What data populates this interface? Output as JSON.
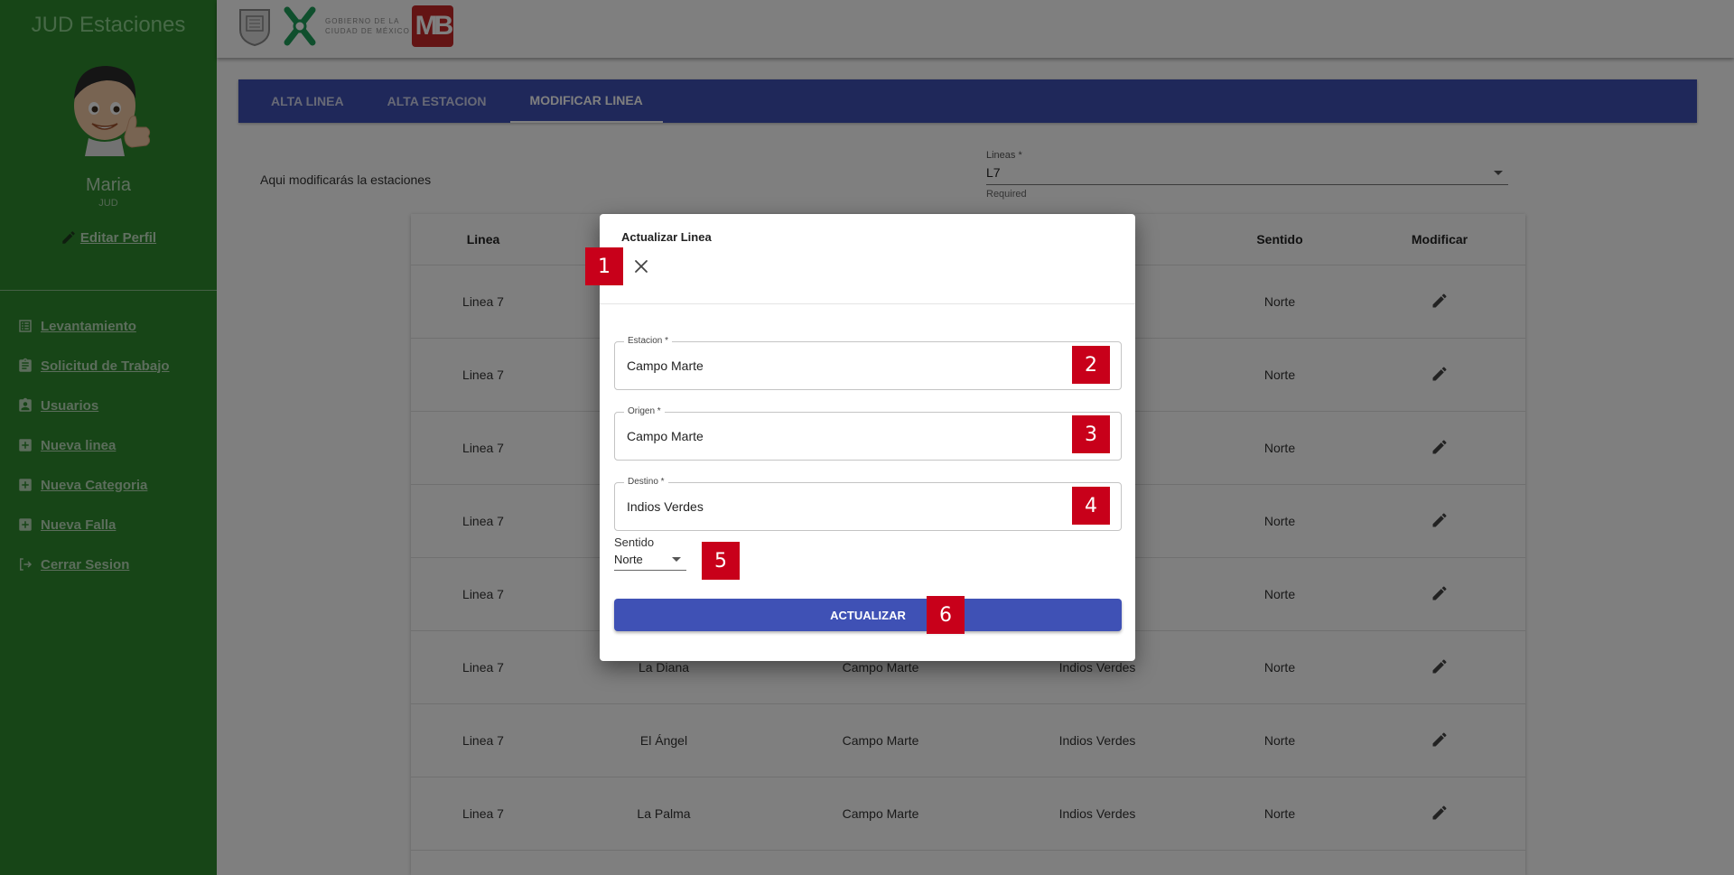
{
  "sidebar": {
    "brand": "JUD Estaciones",
    "user_name": "Maria",
    "user_role": "JUD",
    "edit_profile": "Editar Perfil",
    "items": [
      {
        "label": "Levantamiento",
        "icon": "list-icon"
      },
      {
        "label": "Solicitud de Trabajo",
        "icon": "clipboard-icon"
      },
      {
        "label": "Usuarios",
        "icon": "user-badge-icon"
      },
      {
        "label": "Nueva linea",
        "icon": "add-box-icon"
      },
      {
        "label": "Nueva Categoria",
        "icon": "add-box-icon"
      },
      {
        "label": "Nueva Falla",
        "icon": "add-box-icon"
      },
      {
        "label": "Cerrar Sesion",
        "icon": "logout-icon"
      }
    ]
  },
  "header": {
    "logo_text_line1": "GOBIERNO DE LA",
    "logo_text_line2": "CIUDAD DE MÉXICO"
  },
  "tabs": [
    {
      "label": "ALTA LINEA",
      "active": false
    },
    {
      "label": "ALTA ESTACION",
      "active": false
    },
    {
      "label": "MODIFICAR LINEA",
      "active": true
    }
  ],
  "main": {
    "description": "Aqui modificarás la estaciones",
    "lines_select": {
      "label": "Lineas *",
      "value": "L7",
      "helper": "Required"
    }
  },
  "table": {
    "headers": [
      "Linea",
      "",
      "",
      "",
      "Sentido",
      "Modificar"
    ],
    "rows": [
      [
        "Linea 7",
        "",
        "",
        "",
        "Norte"
      ],
      [
        "Linea 7",
        "",
        "",
        "",
        "Norte"
      ],
      [
        "Linea 7",
        "",
        "",
        "",
        "Norte"
      ],
      [
        "Linea 7",
        "",
        "",
        "",
        "Norte"
      ],
      [
        "Linea 7",
        "",
        "",
        "",
        "Norte"
      ],
      [
        "Linea 7",
        "La Diana",
        "Campo Marte",
        "Indios Verdes",
        "Norte"
      ],
      [
        "Linea 7",
        "El Ángel",
        "Campo Marte",
        "Indios Verdes",
        "Norte"
      ],
      [
        "Linea 7",
        "La Palma",
        "Campo Marte",
        "Indios Verdes",
        "Norte"
      ]
    ]
  },
  "modal": {
    "title": "Actualizar Linea",
    "estacion": {
      "label": "Estacion *",
      "value": "Campo Marte"
    },
    "origen": {
      "label": "Origen *",
      "value": "Campo Marte"
    },
    "destino": {
      "label": "Destino *",
      "value": "Indios Verdes"
    },
    "sentido": {
      "label": "Sentido",
      "value": "Norte"
    },
    "submit": "ACTUALIZAR"
  },
  "badges": [
    "1",
    "2",
    "3",
    "4",
    "5",
    "6"
  ],
  "colors": {
    "sidebar": "#2e8b2e",
    "primary": "#3f51b5",
    "badge": "#c8001a"
  }
}
